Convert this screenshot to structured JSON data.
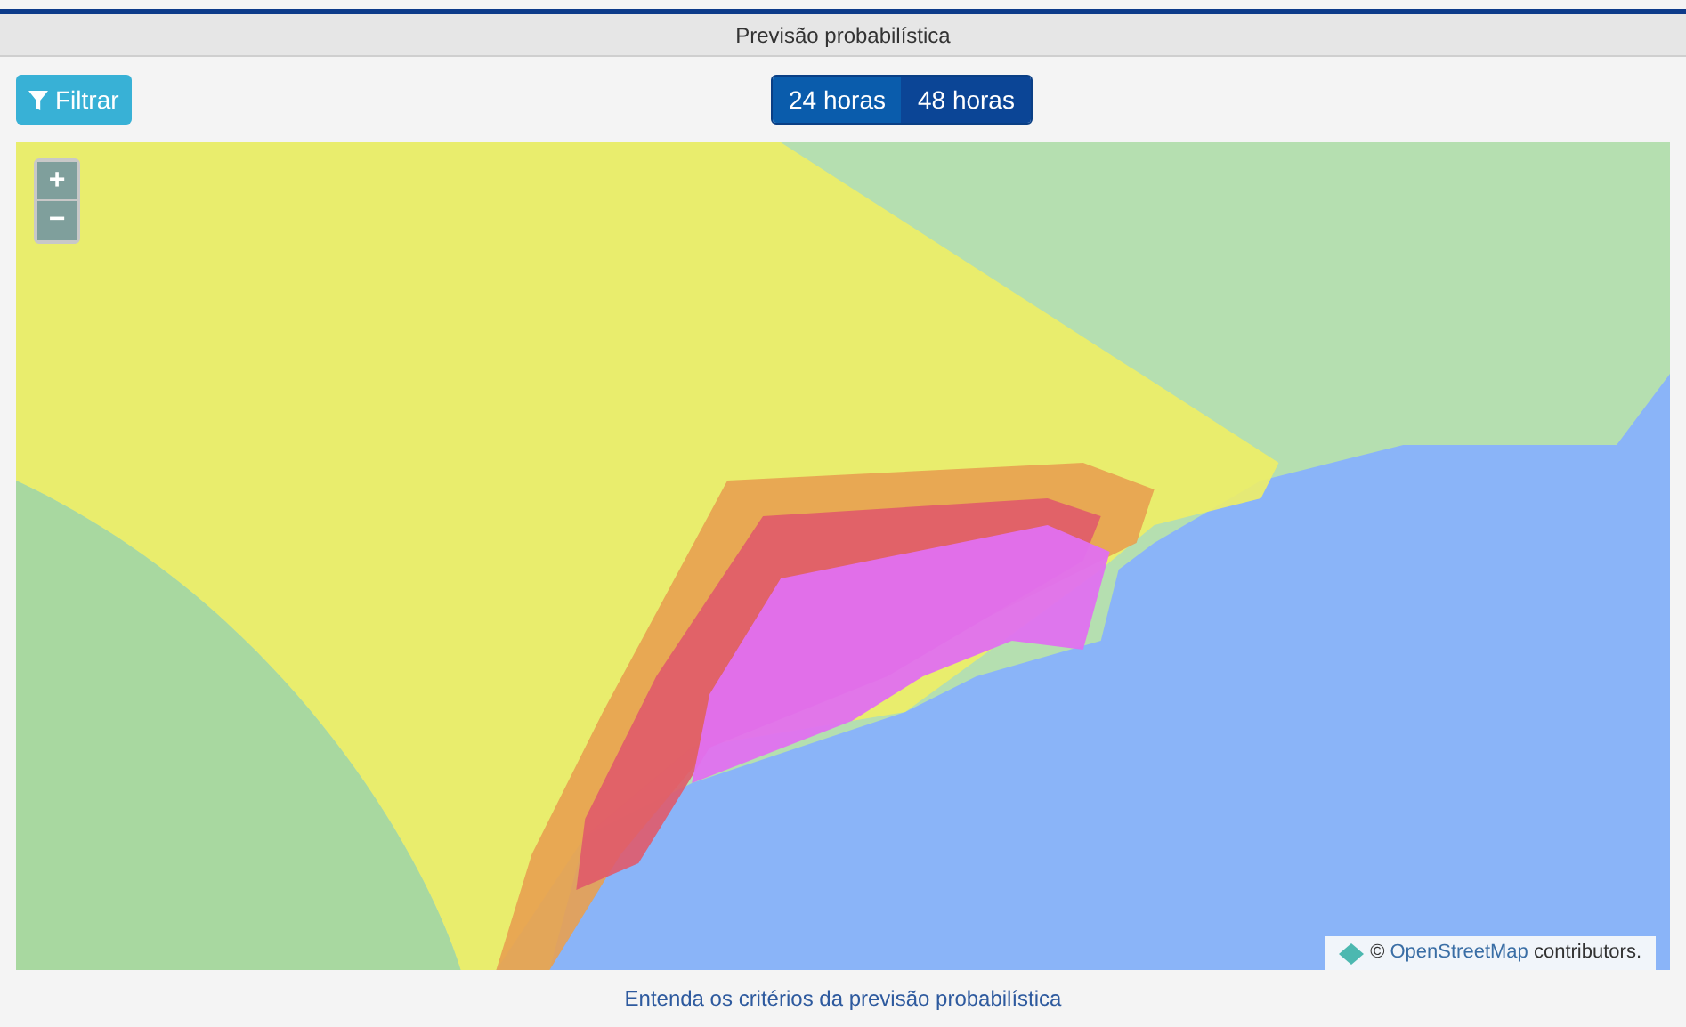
{
  "window": {
    "title": "Previsão probabilística"
  },
  "filter_button": {
    "label": "Filtrar"
  },
  "tabs": [
    {
      "label": "24 horas",
      "selected": false
    },
    {
      "label": "48 horas",
      "selected": true
    }
  ],
  "map": {
    "zoom_in": "+",
    "zoom_out": "−",
    "attribution": {
      "prefix": "©",
      "link": "OpenStreetMap",
      "suffix": "contributors."
    }
  },
  "footer_link": "Entenda os critérios da previsão probabilística"
}
